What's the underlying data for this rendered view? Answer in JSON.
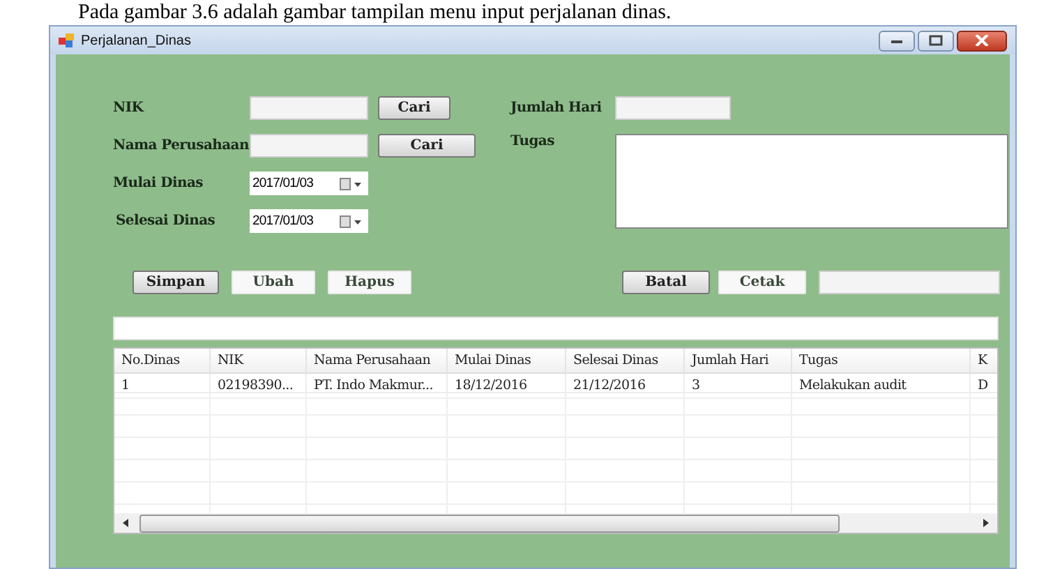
{
  "caption": "Pada gambar 3.6 adalah gambar tampilan menu  input perjalanan dinas.",
  "window": {
    "title": "Perjalanan_Dinas"
  },
  "form": {
    "nik": {
      "label": "NIK",
      "button": {
        "label": "Cari",
        "kind": "raised"
      }
    },
    "perusahaan": {
      "label": "Nama Perusahaan",
      "button": {
        "label": "Cari",
        "kind": "raised"
      }
    },
    "mulai": {
      "label": "Mulai Dinas",
      "value": "2017/01/03"
    },
    "selesai": {
      "label": "Selesai Dinas",
      "value": "2017/01/03"
    },
    "jumlah_hari": {
      "label": "Jumlah Hari"
    },
    "tugas": {
      "label": "Tugas"
    }
  },
  "buttons_left": [
    {
      "label": "Simpan",
      "kind": "raised"
    },
    {
      "label": "Ubah",
      "kind": "flat"
    },
    {
      "label": "Hapus",
      "kind": "flat"
    }
  ],
  "buttons_right": [
    {
      "label": "Batal",
      "kind": "raised"
    },
    {
      "label": "Cetak",
      "kind": "flat"
    }
  ],
  "table": {
    "columns": [
      "No.Dinas",
      "NIK",
      "Nama Perusahaan",
      "Mulai Dinas",
      "Selesai Dinas",
      "Jumlah Hari",
      "Tugas",
      "K"
    ],
    "rows": [
      [
        "1",
        "02198390...",
        "PT. Indo Makmur...",
        "18/12/2016",
        "21/12/2016",
        "3",
        "Melakukan audit",
        "D"
      ]
    ]
  }
}
